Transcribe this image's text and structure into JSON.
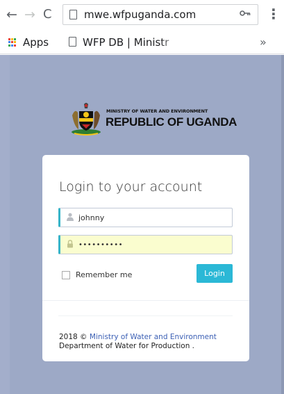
{
  "browser": {
    "url": "mwe.wfpuganda.com",
    "bookmarks": [
      {
        "label": "Apps"
      },
      {
        "label": "WFP DB | Ministr"
      }
    ],
    "more_bookmarks": "»"
  },
  "logo": {
    "ministry": "MINISTRY OF WATER AND ENVIRONMENT",
    "republic": "REPUBLIC OF UGANDA"
  },
  "login": {
    "title": "Login to your account",
    "username_value": "johnny",
    "password_value": "••••••••••",
    "remember_label": "Remember me",
    "login_label": "Login"
  },
  "footer": {
    "prefix": "2018 © ",
    "ministry_link": "Ministry of Water and Environment",
    "line2": "Department of Water for Production ."
  },
  "colors": {
    "page_bg": "#9da9c6",
    "accent": "#2bb8d6",
    "autofill": "#fafdcf",
    "link": "#3b5fb4"
  }
}
